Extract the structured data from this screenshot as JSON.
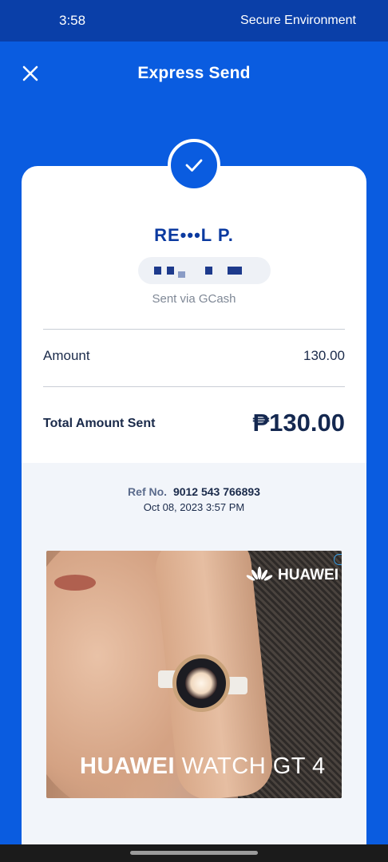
{
  "status_bar": {
    "time": "3:58",
    "environment": "Secure Environment"
  },
  "header": {
    "title": "Express Send",
    "close_icon": "close-icon"
  },
  "receipt": {
    "status_icon": "check-icon",
    "recipient_name": "RE•••L P.",
    "sent_via": "Sent via GCash",
    "amount_label": "Amount",
    "amount_value": "130.00",
    "total_label": "Total Amount Sent",
    "total_value": "₱130.00",
    "ref_label": "Ref No.",
    "ref_number": "9012 543 766893",
    "date": "Oct 08, 2023 3:57 PM"
  },
  "ad": {
    "brand": "HUAWEI",
    "headline_brand": "HUAWEI",
    "headline_product": "WATCH GT 4",
    "info_icon": "ad-info-icon"
  },
  "colors": {
    "primary": "#0a5ce0",
    "status_bar": "#0a3fa8",
    "navy_text": "#1a2a4a",
    "name_blue": "#0b3aa0"
  }
}
